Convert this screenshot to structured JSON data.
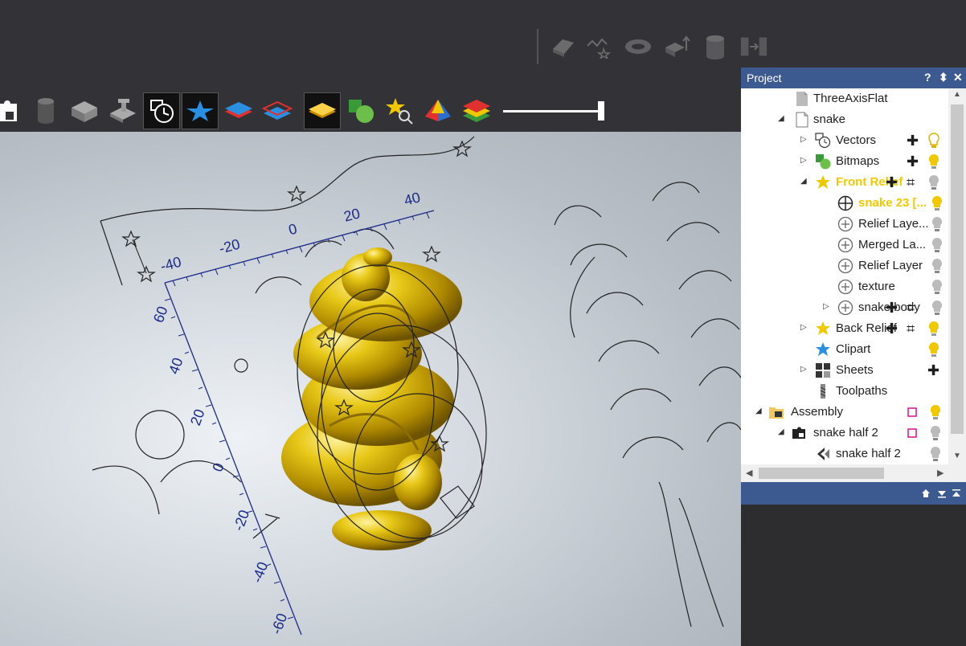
{
  "panel": {
    "title": "Project",
    "help": "?",
    "pin": "⬍",
    "close": "✕"
  },
  "toolbar": {
    "pane_menu": "▼",
    "pane_close": "✕"
  },
  "tree": {
    "items": [
      {
        "label": "ThreeAxisFlat"
      },
      {
        "label": "snake"
      },
      {
        "label": "Vectors"
      },
      {
        "label": "Bitmaps"
      },
      {
        "label": "Front Relief"
      },
      {
        "label": "snake 23 [..."
      },
      {
        "label": "Relief Laye..."
      },
      {
        "label": "Merged La..."
      },
      {
        "label": "Relief Layer"
      },
      {
        "label": "texture"
      },
      {
        "label": "snake body"
      },
      {
        "label": "Back Relief"
      },
      {
        "label": "Clipart"
      },
      {
        "label": "Sheets"
      },
      {
        "label": "Toolpaths"
      },
      {
        "label": "Assembly"
      },
      {
        "label": "snake half 2"
      },
      {
        "label": "snake half 2"
      }
    ]
  },
  "ruler": {
    "h_ticks": [
      "-40",
      "-20",
      "0",
      "20",
      "40"
    ],
    "v_ticks": [
      "60",
      "40",
      "20",
      "0",
      "-20",
      "-40",
      "-60"
    ]
  },
  "colors": {
    "panel_header": "#3c5a8f",
    "relief_gold": "#d4b000",
    "ruler_blue": "#1a2a8a",
    "highlight_yellow": "#f0c800"
  }
}
